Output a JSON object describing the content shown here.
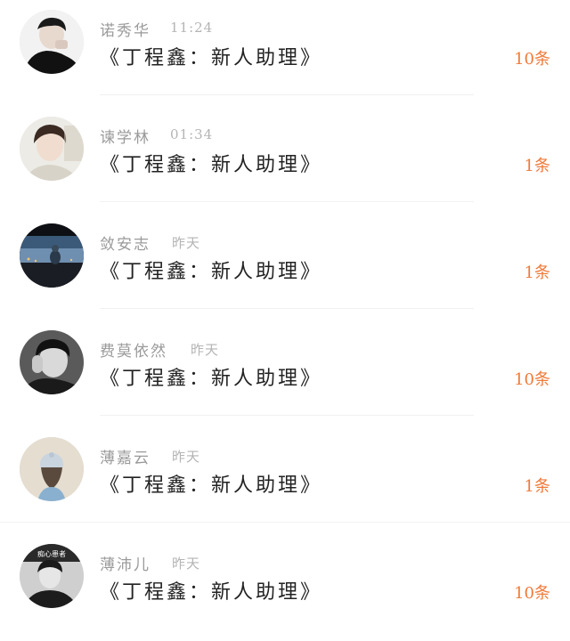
{
  "colors": {
    "name": "#9a9a9a",
    "time": "#b4b4b4",
    "title": "#222222",
    "count": "#f07a3a",
    "divider": "#f1f1f1"
  },
  "messages": [
    {
      "name": "诺秀华",
      "time": "11:24",
      "title": "《丁程鑫：新人助理》",
      "count": "10条",
      "avatar_icon": "person-avatar-icon"
    },
    {
      "name": "谏学林",
      "time": "01:34",
      "title": "《丁程鑫：新人助理》",
      "count": "1条",
      "avatar_icon": "person-avatar-icon"
    },
    {
      "name": "敛安志",
      "time": "昨天",
      "title": "《丁程鑫：新人助理》",
      "count": "1条",
      "avatar_icon": "landscape-avatar-icon"
    },
    {
      "name": "费莫依然",
      "time": "昨天",
      "title": "《丁程鑫：新人助理》",
      "count": "10条",
      "avatar_icon": "person-avatar-icon"
    },
    {
      "name": "薄嘉云",
      "time": "昨天",
      "title": "《丁程鑫：新人助理》",
      "count": "1条",
      "avatar_icon": "person-avatar-icon"
    },
    {
      "name": "薄沛儿",
      "time": "昨天",
      "title": "《丁程鑫：新人助理》",
      "count": "10条",
      "avatar_icon": "person-avatar-icon",
      "avatar_text": "痴心患者"
    }
  ]
}
